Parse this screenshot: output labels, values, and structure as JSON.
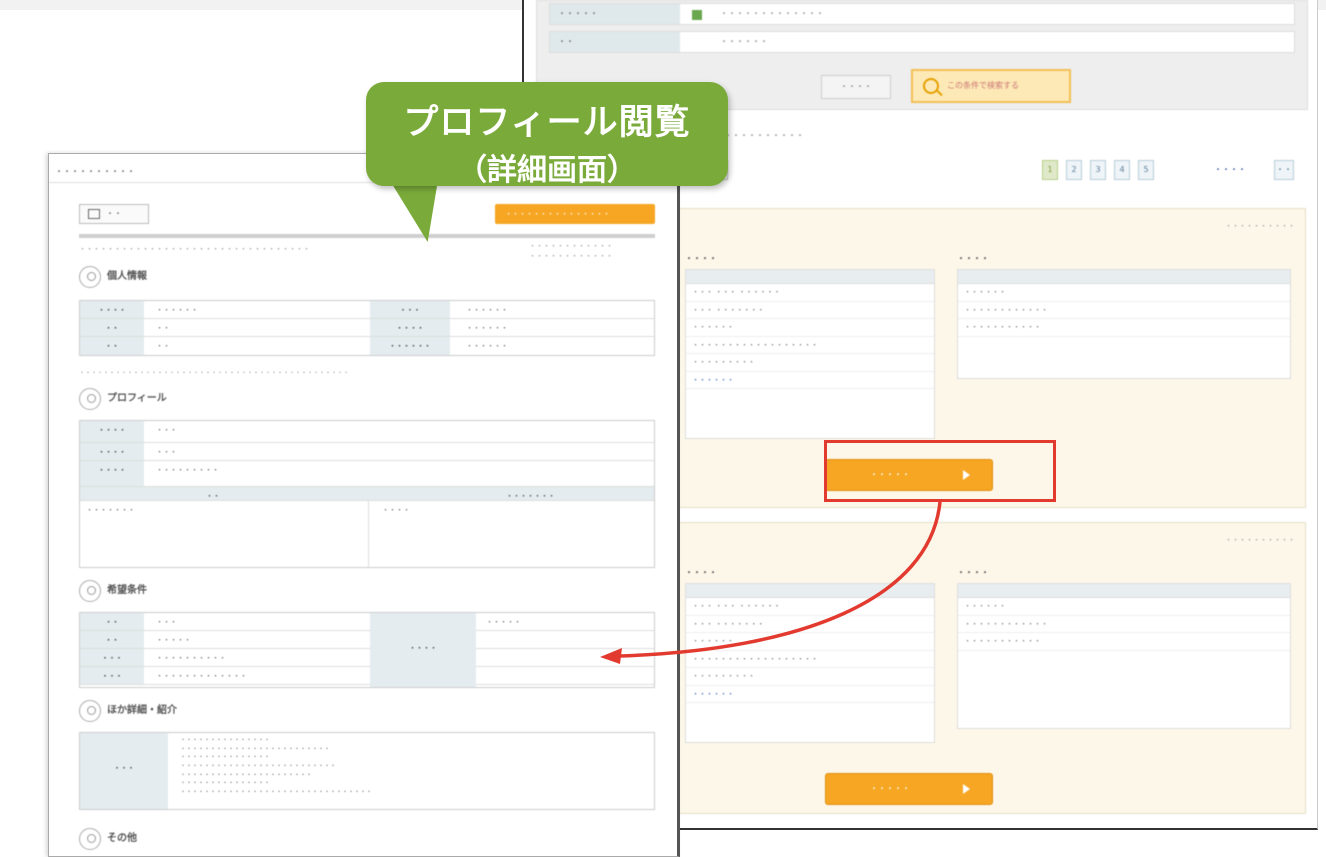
{
  "callout": {
    "line1": "プロフィール閲覧",
    "line2": "（詳細画面）"
  },
  "colors": {
    "accent_orange": "#f6a623",
    "callout_green": "#7aaa3a",
    "highlight_red": "#e23a2f"
  },
  "search_form": {
    "rows": [
      {
        "label": "・・・・・",
        "value": "・・・・・・・・・・・・・"
      },
      {
        "label": "・・",
        "value": "・・・・・・"
      }
    ],
    "clear_label": "・・・・",
    "search_label": "この条件で検索する"
  },
  "results": {
    "count_text": "・・・・・・・・・・",
    "sort_selected": "・・・",
    "pages": [
      "1",
      "2",
      "3",
      "4",
      "5"
    ],
    "next_label": "・・・・",
    "last_label": "・・",
    "cards": [
      {
        "date": "・・・・・・・・・・",
        "basic_heading": "・・・・",
        "hope_heading": "・・・・",
        "basic_lines": [
          "・・・ ・・・ ・・・・・・",
          "・・・ ・・・・・・・",
          "・・・・・・",
          "・・・・・・・・・・・・・・・・・・",
          "・・・・・・・・・"
        ],
        "basic_link": "・・・・・・",
        "hope_lines": [
          "・・・・・・",
          "・・・・・・・・・・・・",
          "・・・・・・・・・・・"
        ],
        "button": "・・・・・"
      },
      {
        "date": "・・・・・・・・・・",
        "basic_heading": "・・・・",
        "hope_heading": "・・・・",
        "basic_lines": [
          "・・・ ・・・ ・・・・・・",
          "・・・ ・・・・・・・",
          "・・・・・・",
          "・・・・・・・・・・・・・・・・・・",
          "・・・・・・・・・"
        ],
        "basic_link": "・・・・・・",
        "hope_lines": [
          "・・・・・・",
          "・・・・・・・・・・・・",
          "・・・・・・・・・・・"
        ],
        "button": "・・・・・"
      }
    ]
  },
  "profile": {
    "window_title": "・・・・・・・・・・",
    "print_label": "・・",
    "back_label": "・・・・・・・・・・・・・・・",
    "breadcrumb": "・・・・・・・・・・・・・・・・・・・・・・・・・・・・・・・・・",
    "reg_date_1": "・・・・・・・・・・・・",
    "reg_date_2": "・・・・・・・・・・・・",
    "sections": {
      "personal": "個人情報",
      "profile": "プロフィール",
      "wish": "希望条件",
      "intro": "ほか詳細・紹介",
      "other": "その他"
    },
    "personal_rows": [
      {
        "l1": "・・・・",
        "v1": "・・・・・・",
        "l2": "・・・",
        "v2": "・・・・・・"
      },
      {
        "l1": "・・",
        "v1": "・・",
        "l2": "・・・・",
        "v2": "・・・・・・"
      },
      {
        "l1": "・・",
        "v1": "・・",
        "l2": "・・・・・・",
        "v2": "・・・・・・"
      }
    ],
    "note": "・・・・・・・・・・・・・・・・・・・・・・・・・・・・・・・・・・・・・・・・・・・・・",
    "profile_rows": [
      {
        "l": "・・・・",
        "v": "・・・"
      },
      {
        "l": "・・・・",
        "v": "・・・"
      },
      {
        "l": "・・・・",
        "v": "・・・・・・・・・"
      }
    ],
    "profile_sub_headers": [
      "・・",
      "・・・・・・・"
    ],
    "profile_sub_values": [
      "・・・・・・・",
      "・・・・"
    ],
    "wish_rows": [
      {
        "l": "・・",
        "v": "・・・"
      },
      {
        "l": "・・",
        "v": "・・・・・"
      },
      {
        "l": "・・・",
        "v": "・・・・・・・・・・"
      },
      {
        "l": "・・・",
        "v": "・・・・・・・・・・・・・"
      }
    ],
    "wish_side_label": "・・・・",
    "wish_side_value": "・・・・・",
    "intro_label": "・・・",
    "intro_lines": [
      "・・・・・・・・・・・・・・・",
      "・・・・・・・・・・・・・・・・・・・・・・・・・",
      "・・・・・・・・・・・・・・・",
      "・・・・・・・・・・・・・・・・・・・・・・・・・・",
      "・・・・・・・・・・・・・・・・・・・・・・",
      "・・・・・・・・・・・・・・・",
      "・・・・・・・・・・・・・・・・・・・・・・・・・・・・・・・・"
    ]
  }
}
